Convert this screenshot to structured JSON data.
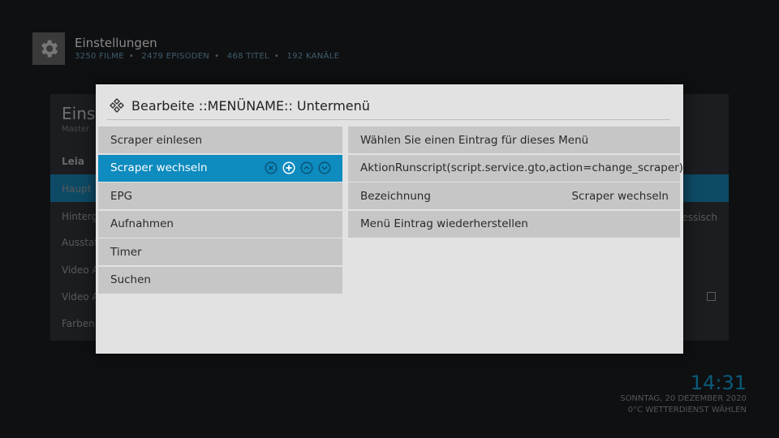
{
  "background": {
    "app_title": "Einstellungen",
    "stats": [
      "3250 FILME",
      "2479 EPISODEN",
      "468 TITEL",
      "192 KANÄLE"
    ],
    "section_title": "Einst",
    "section_subtitle": "Master",
    "rows": [
      "Leia",
      "Haupt",
      "Hinterg",
      "Ausstat",
      "Video A",
      "Video A",
      "Farben"
    ],
    "row_right_value": "essisch",
    "clock": "14:31",
    "date": "SONNTAG, 20 DEZEMBER 2020",
    "weather": "0°C  WETTERDIENST WÄHLEN"
  },
  "dialog": {
    "title": "Bearbeite ::MENÜNAME:: Untermenü",
    "title_icon": "kodi-logo-icon",
    "menu_items": [
      {
        "label": "Scraper einlesen"
      },
      {
        "label": "Scraper wechseln"
      },
      {
        "label": "EPG"
      },
      {
        "label": "Aufnahmen"
      },
      {
        "label": "Timer"
      },
      {
        "label": "Suchen"
      }
    ],
    "selected_controls": [
      "remove-icon",
      "add-icon",
      "move-up-icon",
      "move-down-icon"
    ],
    "properties": [
      {
        "label": "Wählen Sie einen Eintrag für dieses Menü",
        "value": ""
      },
      {
        "label": "Aktion",
        "value": "Runscript(script.service.gto,action=change_scraper)"
      },
      {
        "label": "Bezeichnung",
        "value": "Scraper wechseln"
      },
      {
        "label": "Menü Eintrag wiederherstellen",
        "value": ""
      }
    ]
  },
  "colors": {
    "accent": "#0e8bbf",
    "dialog_bg": "#e2e2e2",
    "item_bg": "#c6c6c6"
  }
}
